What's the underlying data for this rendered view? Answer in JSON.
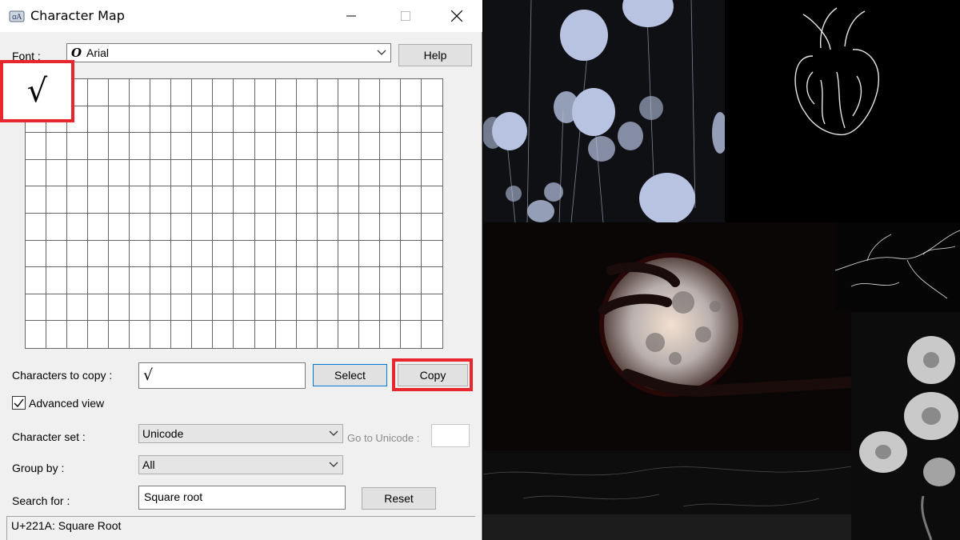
{
  "window": {
    "title": "Character Map"
  },
  "font": {
    "label": "Font :",
    "value": "Arial",
    "help_label": "Help"
  },
  "grid": {
    "selected_char": "√"
  },
  "copy_row": {
    "label": "Characters to copy :",
    "value": "√",
    "select_label": "Select",
    "copy_label": "Copy"
  },
  "advanced": {
    "label": "Advanced view",
    "checked": true
  },
  "charset": {
    "label": "Character set :",
    "value": "Unicode",
    "goto_label": "Go to Unicode :"
  },
  "groupby": {
    "label": "Group by :",
    "value": "All"
  },
  "search": {
    "label": "Search for :",
    "value": "Square root",
    "reset_label": "Reset"
  },
  "status": {
    "text": "U+221A: Square Root"
  },
  "colors": {
    "highlight": "#e8262d",
    "focus_border": "#0078d7"
  }
}
